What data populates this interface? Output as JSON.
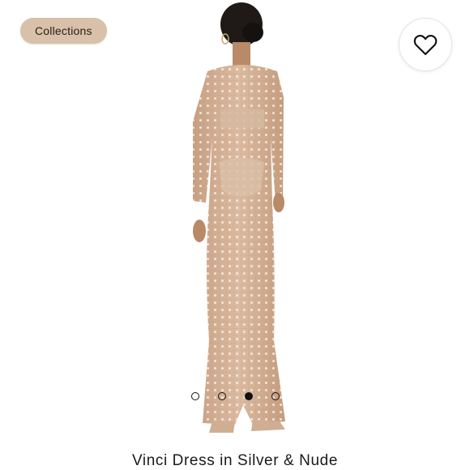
{
  "header": {
    "collections_label": "Collections"
  },
  "icons": {
    "favorite": "heart-icon"
  },
  "gallery": {
    "image_count": 4,
    "active_index": 2
  },
  "product": {
    "title": "Vinci Dress in Silver & Nude"
  },
  "colors": {
    "chip_background": "#d9c0a8",
    "dress": "#d8b59a",
    "indicator": "#111111"
  }
}
